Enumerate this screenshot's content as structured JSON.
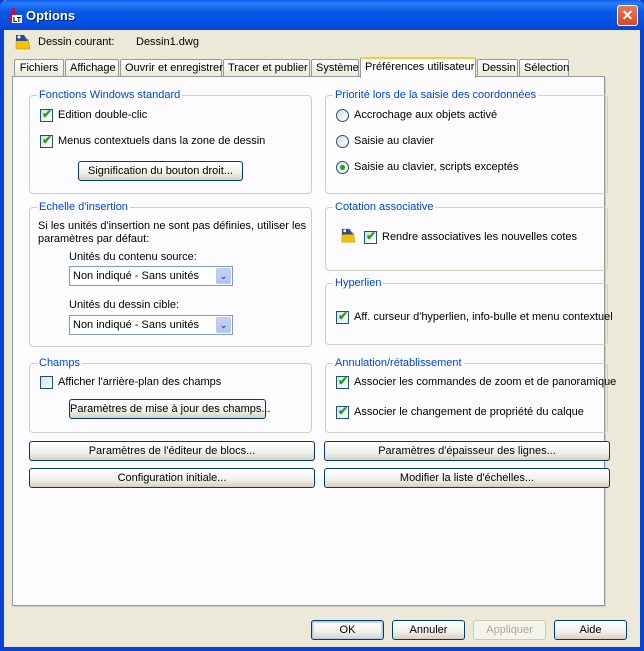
{
  "window": {
    "title": "Options",
    "close_label": "✕"
  },
  "current_drawing": {
    "label": "Dessin courant:",
    "value": "Dessin1.dwg"
  },
  "tabs": [
    {
      "label": "Fichiers",
      "active": false
    },
    {
      "label": "Affichage",
      "active": false
    },
    {
      "label": "Ouvrir et enregistrer",
      "active": false
    },
    {
      "label": "Tracer et publier",
      "active": false
    },
    {
      "label": "Système",
      "active": false
    },
    {
      "label": "Préférences utilisateur",
      "active": true
    },
    {
      "label": "Dessin",
      "active": false
    },
    {
      "label": "Sélection",
      "active": false
    }
  ],
  "windows_functions": {
    "title": "Fonctions Windows standard",
    "double_click_edit": {
      "label": "Edition double-clic",
      "checked": true
    },
    "shortcut_menus": {
      "label": "Menus contextuels dans la zone de dessin",
      "checked": true
    },
    "right_click_button": "Signification du bouton droit..."
  },
  "coord_priority": {
    "title": "Priorité lors de la saisie des coordonnées",
    "options": [
      {
        "label": "Accrochage aux objets activé",
        "selected": false
      },
      {
        "label": "Saisie au clavier",
        "selected": false
      },
      {
        "label": "Saisie au clavier, scripts exceptés",
        "selected": true
      }
    ]
  },
  "insertion_scale": {
    "title": "Echelle d'insertion",
    "description_line1": "Si les unités d'insertion ne sont pas définies, utiliser les",
    "description_line2": "paramètres par défaut:",
    "source_label": "Unités du contenu source:",
    "source_value": "Non indiqué - Sans unités",
    "target_label": "Unités du dessin cible:",
    "target_value": "Non indiqué - Sans unités",
    "arrow": "⌄"
  },
  "associative_dim": {
    "title": "Cotation associative",
    "make_associative": {
      "label": "Rendre associatives les nouvelles cotes",
      "checked": true
    }
  },
  "hyperlink": {
    "title": "Hyperlien",
    "display": {
      "label": "Aff. curseur d'hyperlien, info-bulle et menu contextuel",
      "checked": true
    }
  },
  "fields": {
    "title": "Champs",
    "background": {
      "label": "Afficher l'arrière-plan des champs",
      "checked": false
    },
    "update_button": "Paramètres de mise à jour des champs..."
  },
  "undo_redo": {
    "title": "Annulation/rétablissement",
    "combine_zoom": {
      "label": "Associer les commandes de zoom et de panoramique",
      "checked": true
    },
    "combine_layer": {
      "label": "Associer le changement de propriété du calque",
      "checked": true
    }
  },
  "buttons": {
    "block_editor": "Paramètres de l'éditeur de blocs...",
    "initial_setup": "Configuration initiale...",
    "lineweight": "Paramètres d'épaisseur des lignes...",
    "scale_list": "Modifier la liste d'échelles..."
  },
  "footer": {
    "ok": "OK",
    "cancel": "Annuler",
    "apply": "Appliquer",
    "help": "Aide"
  },
  "colors": {
    "titlebar": "#0842d4",
    "group_title": "#0046d5",
    "check": "#21a121",
    "dialog_bg": "#ece9d8"
  }
}
